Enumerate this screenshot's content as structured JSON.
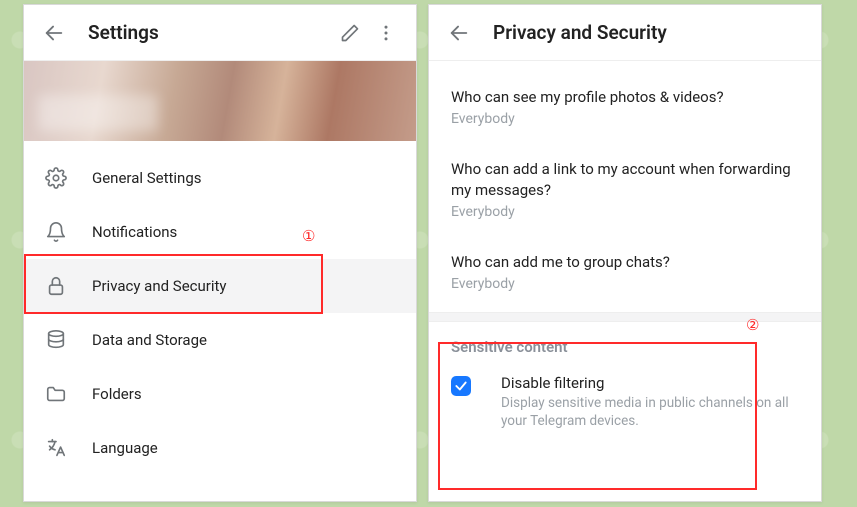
{
  "left": {
    "title": "Settings",
    "items": [
      {
        "label": "General Settings"
      },
      {
        "label": "Notifications"
      },
      {
        "label": "Privacy and Security"
      },
      {
        "label": "Data and Storage"
      },
      {
        "label": "Folders"
      },
      {
        "label": "Language"
      }
    ]
  },
  "right": {
    "title": "Privacy and Security",
    "privacy": [
      {
        "q": "Who can see my profile photos & videos?",
        "a": "Everybody"
      },
      {
        "q": "Who can add a link to my account when forwarding my messages?",
        "a": "Everybody"
      },
      {
        "q": "Who can add me to group chats?",
        "a": "Everybody"
      }
    ],
    "sensitive": {
      "header": "Sensitive content",
      "checkbox_label": "Disable filtering",
      "checkbox_desc": "Display sensitive media in public channels on all your Telegram devices.",
      "checked": true
    }
  },
  "callouts": {
    "one": "①",
    "two": "②"
  }
}
